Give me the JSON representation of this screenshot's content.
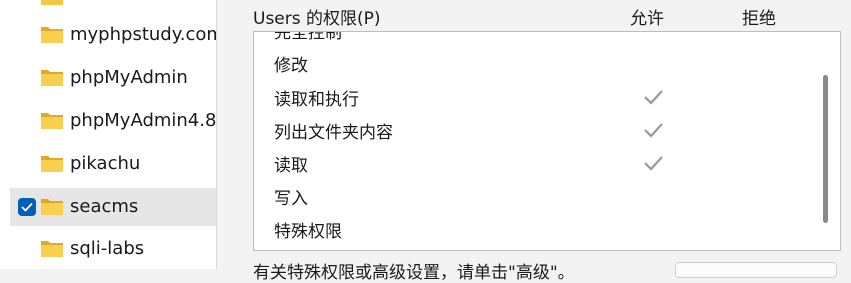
{
  "file_list": {
    "items": [
      {
        "label": "myphpstudy.com",
        "selected": false
      },
      {
        "label": "phpMyAdmin",
        "selected": false
      },
      {
        "label": "phpMyAdmin4.8",
        "selected": false
      },
      {
        "label": "pikachu",
        "selected": false
      },
      {
        "label": "seacms",
        "selected": true
      },
      {
        "label": "sqli-labs",
        "selected": false
      }
    ]
  },
  "permissions": {
    "header": "Users 的权限(P)",
    "allow_label": "允许",
    "deny_label": "拒绝",
    "rows": [
      {
        "name": "完全控制",
        "allow": false,
        "deny": false
      },
      {
        "name": "修改",
        "allow": false,
        "deny": false
      },
      {
        "name": "读取和执行",
        "allow": true,
        "deny": false
      },
      {
        "name": "列出文件夹内容",
        "allow": true,
        "deny": false
      },
      {
        "name": "读取",
        "allow": true,
        "deny": false
      },
      {
        "name": "写入",
        "allow": false,
        "deny": false
      },
      {
        "name": "特殊权限",
        "allow": false,
        "deny": false
      }
    ]
  },
  "bottom": {
    "text": "有关特殊权限或高级设置，请单击\"高级\"。"
  },
  "colors": {
    "checkbox_accent": "#005fb8",
    "folder_yellow": "#f2c744",
    "checkmark_gray": "#9a9a9a"
  }
}
